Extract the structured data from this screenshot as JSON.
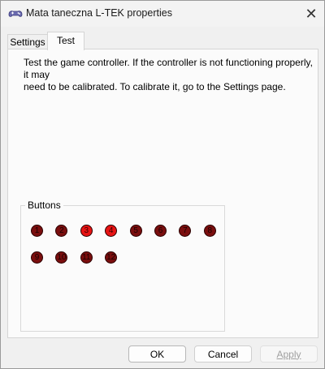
{
  "window": {
    "title": "Mata taneczna L-TEK properties",
    "close_glyph": "✕"
  },
  "tabs": [
    {
      "label": "Settings",
      "active": false
    },
    {
      "label": "Test",
      "active": true
    }
  ],
  "test_page": {
    "description": "Test the game controller.  If the controller is not functioning properly, it may\nneed to be calibrated.  To calibrate it, go to the Settings page.",
    "buttons_group": {
      "label": "Buttons",
      "buttons": [
        {
          "label": "1",
          "pressed": false
        },
        {
          "label": "2",
          "pressed": false
        },
        {
          "label": "3",
          "pressed": true
        },
        {
          "label": "4",
          "pressed": true
        },
        {
          "label": "5",
          "pressed": false
        },
        {
          "label": "6",
          "pressed": false
        },
        {
          "label": "7",
          "pressed": false
        },
        {
          "label": "8",
          "pressed": false
        },
        {
          "label": "9",
          "pressed": false
        },
        {
          "label": "10",
          "pressed": false
        },
        {
          "label": "11",
          "pressed": false
        },
        {
          "label": "12",
          "pressed": false
        }
      ]
    }
  },
  "footer": {
    "ok_label": "OK",
    "cancel_label": "Cancel",
    "apply_label": "Apply",
    "apply_enabled": false
  },
  "colors": {
    "button_off": "#7a0e0e",
    "button_on": "#e81414",
    "button_border": "#2a0000"
  }
}
